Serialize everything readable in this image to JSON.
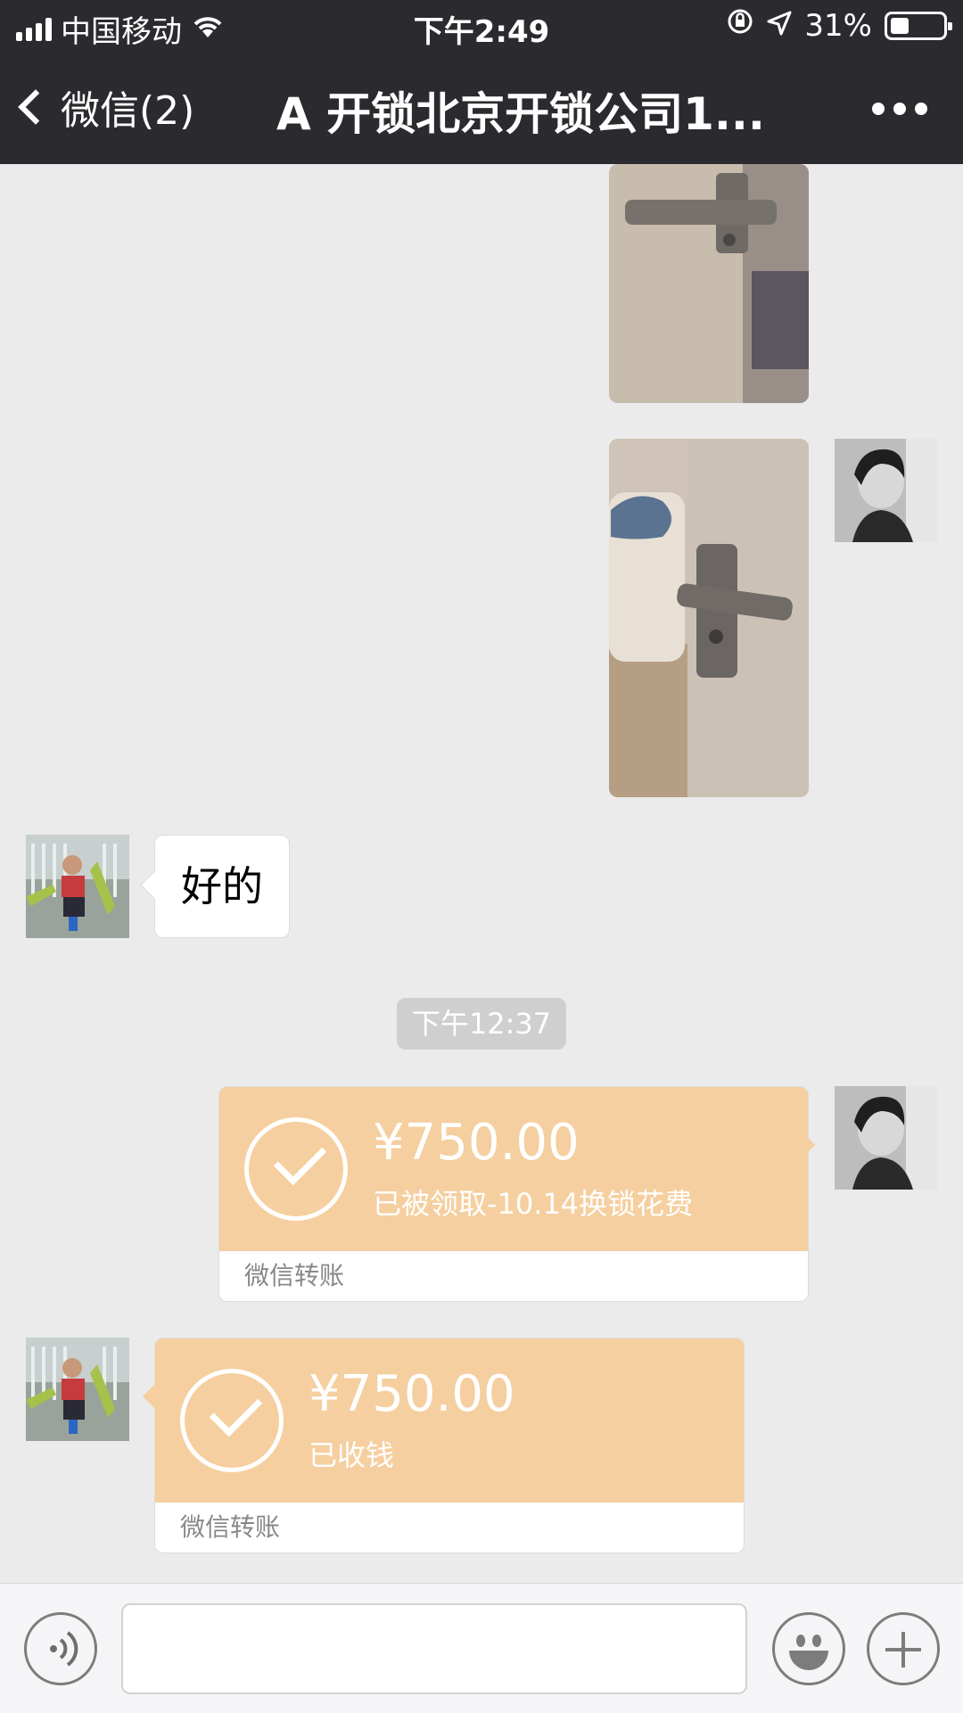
{
  "status_bar": {
    "carrier": "中国移动",
    "time": "下午2:49",
    "battery": "31%",
    "battery_level": 0.31
  },
  "nav": {
    "back_label": "微信(2)",
    "title": "A   开锁北京开锁公司1..."
  },
  "messages": {
    "reply_text": "好的",
    "timestamp": "下午12:37",
    "transfer_out": {
      "amount": "¥750.00",
      "note": "已被领取-10.14换锁花费",
      "footer": "微信转账"
    },
    "transfer_in": {
      "amount": "¥750.00",
      "note": "已收钱",
      "footer": "微信转账"
    }
  },
  "icons": {
    "back": "chevron-left-icon",
    "more": "more-icon",
    "voice": "voice-icon",
    "emoji": "emoji-icon",
    "plus": "plus-icon",
    "check": "check-icon"
  },
  "colors": {
    "nav_bg": "#2b2b2f",
    "chat_bg": "#ebebeb",
    "transfer_bg": "#f5cf9f"
  }
}
